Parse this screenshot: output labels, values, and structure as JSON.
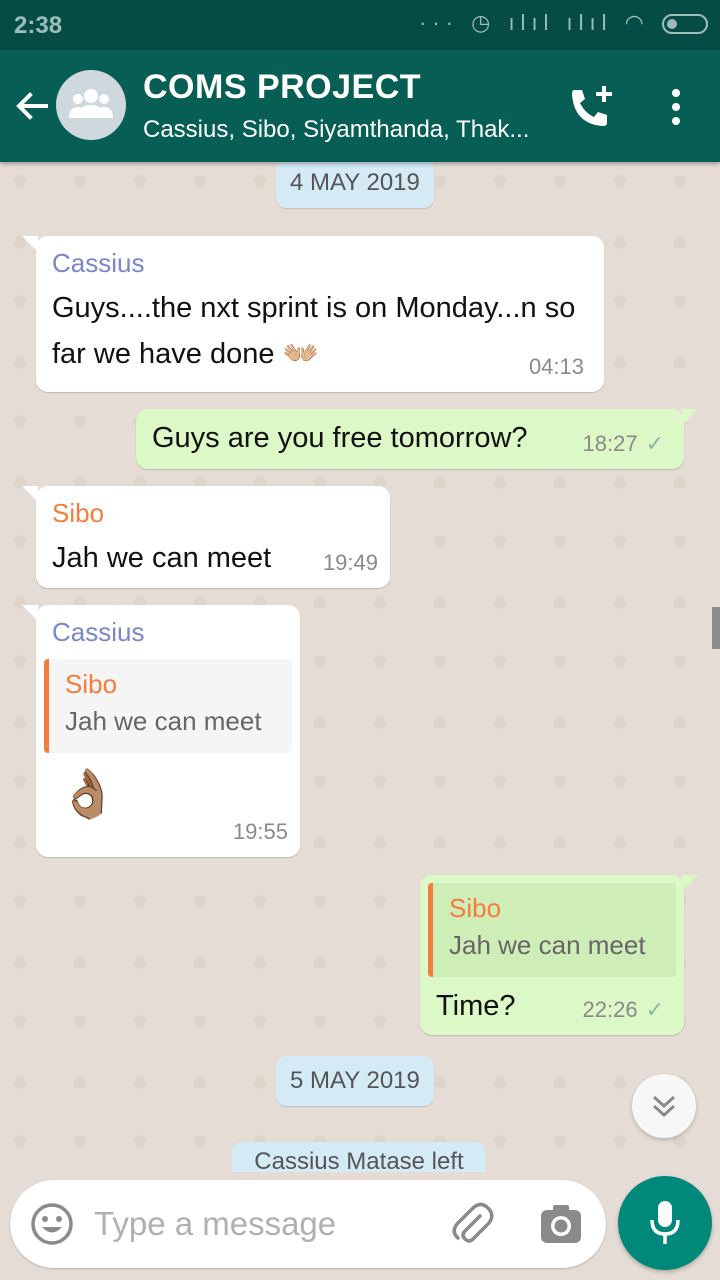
{
  "status_bar": {
    "time": "2:38",
    "icons": "··· ◷ ılıl ılıl ◠"
  },
  "header": {
    "title": "COMS PROJECT",
    "subtitle": "Cassius, Sibo, Siyamthanda, Thak...",
    "back_icon": "arrow-left-icon",
    "call_icon": "add-call-icon",
    "menu_icon": "more-vert-icon"
  },
  "date_chips": [
    "4 MAY 2019",
    "5 MAY 2019"
  ],
  "messages": [
    {
      "direction": "in",
      "sender": "Cassius",
      "text": "Guys....the nxt sprint is on Monday...n so far we have done 👐🏼",
      "time": "04:13"
    },
    {
      "direction": "out",
      "text": "Guys are you free tomorrow?",
      "time": "18:27",
      "status": "✓"
    },
    {
      "direction": "in",
      "sender": "Sibo",
      "text": "Jah we can meet",
      "time": "19:49"
    },
    {
      "direction": "in",
      "sender": "Cassius",
      "quote": {
        "sender": "Sibo",
        "text": "Jah we can meet"
      },
      "text": "👌🏽",
      "time": "19:55"
    },
    {
      "direction": "out",
      "quote": {
        "sender": "Sibo",
        "text": "Jah we can meet"
      },
      "text": "Time?",
      "time": "22:26",
      "status": "✓"
    }
  ],
  "system_message": "Cassius Matase left",
  "composer": {
    "placeholder": "Type a message",
    "emoji_icon": "emoji-icon",
    "attach_icon": "paperclip-icon",
    "camera_icon": "camera-icon",
    "mic_icon": "mic-icon"
  },
  "scroll_button_icon": "double-chevron-down-icon",
  "colors": {
    "header": "#075e54",
    "status_bar": "#054d44",
    "chat_bg": "#e5ddd5",
    "outgoing_bubble": "#dcf8c6",
    "date_chip": "#d4eaf4",
    "sender_cassius": "#7986cb",
    "sender_sibo": "#f57c3c",
    "check": "#8fb4a4",
    "mic_fab": "#00897b"
  }
}
